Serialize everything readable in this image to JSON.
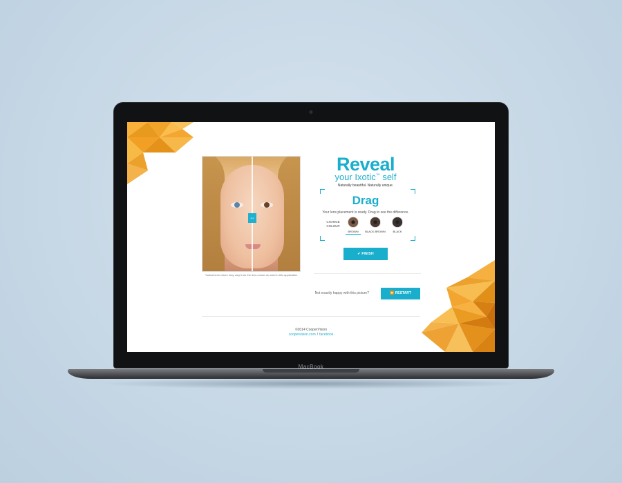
{
  "device": {
    "brand": "MacBook"
  },
  "hero": {
    "title": "Reveal",
    "subtitle_pre": "your Ixotic",
    "subtitle_tm": "™",
    "subtitle_post": " self",
    "tagline": "Naturally beautiful. Naturally unique."
  },
  "photo": {
    "disclaimer": "*Actual lens colour may vary from the lens colour as used in this application",
    "handle_icon": "drag-arrows-icon"
  },
  "drag": {
    "heading": "Drag",
    "instruction": "Your lens placement is ready. Drag to see the difference.",
    "change_line1": "CHANGE",
    "change_line2": "COLOUR"
  },
  "colours": [
    {
      "label": "BROWN",
      "color": "#7a5a45",
      "selected": true
    },
    {
      "label": "BLACK BROWN",
      "color": "#4a3a30",
      "selected": false
    },
    {
      "label": "BLACK",
      "color": "#3a3230",
      "selected": false
    }
  ],
  "actions": {
    "finish_label": "FINISH",
    "finish_icon": "check-icon",
    "unhappy_text": "Not exactly happy with this picture?",
    "restart_label": "RESTART",
    "restart_icon": "rewind-icon"
  },
  "footer": {
    "copyright": "©2014 CooperVision",
    "link1": "coopervision.com",
    "separator": "/",
    "link2": "facebook"
  },
  "colors": {
    "accent": "#1aaecd",
    "orange": "#f5a623",
    "dark_orange": "#d07c10"
  }
}
